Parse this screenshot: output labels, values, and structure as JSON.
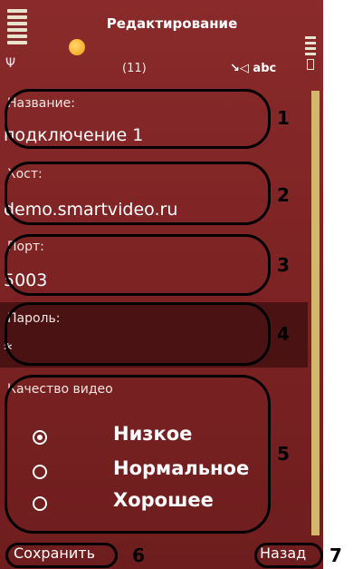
{
  "header": {
    "title": "Редактирование",
    "counter": "(11)",
    "input_mode": "abc",
    "icons": [
      "signal-icon",
      "antenna-icon",
      "app-icon",
      "pen-icon",
      "battery-icon"
    ]
  },
  "form": {
    "name_label": "Название:",
    "name_value": "подключение 1",
    "host_label": "Хост:",
    "host_value": "demo.smartvideo.ru",
    "port_label": "Порт:",
    "port_value": "5003",
    "password_label": "Пароль:",
    "password_value": "*",
    "quality_label": "Качество видео",
    "quality_options": [
      {
        "label": "Низкое",
        "selected": true
      },
      {
        "label": "Нормальное",
        "selected": false
      },
      {
        "label": "Хорошее",
        "selected": false
      }
    ]
  },
  "softkeys": {
    "left": "Сохранить",
    "right": "Назад"
  },
  "annotations": [
    "1",
    "2",
    "3",
    "4",
    "5",
    "6",
    "7"
  ],
  "colors": {
    "background": "#7b2223",
    "selected_field": "#4a1213",
    "scrollbar": "#d4b66d"
  }
}
